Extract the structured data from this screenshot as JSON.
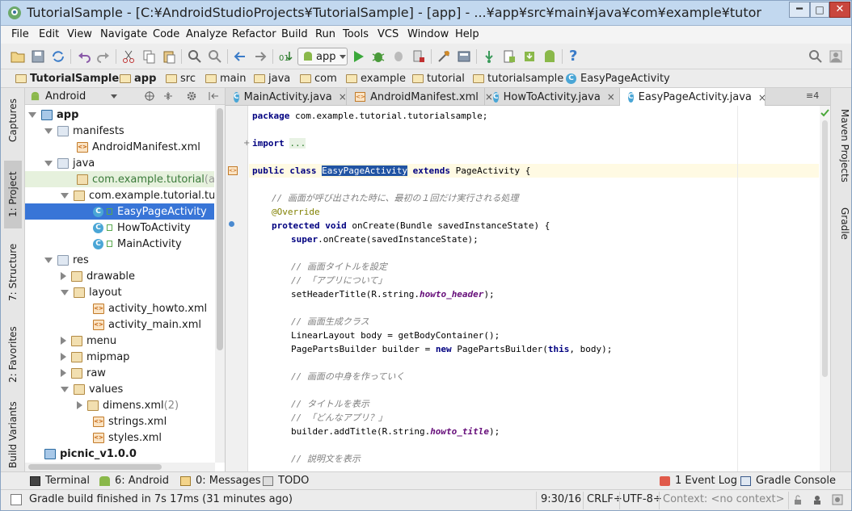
{
  "window": {
    "title": "TutorialSample - [C:¥AndroidStudioProjects¥TutorialSample] - [app] - ...¥app¥src¥main¥java¥com¥example¥tutorial¥tut...",
    "minimize": "━",
    "maximize": "□",
    "close": "✕"
  },
  "menu": [
    "File",
    "Edit",
    "View",
    "Navigate",
    "Code",
    "Analyze",
    "Refactor",
    "Build",
    "Run",
    "Tools",
    "VCS",
    "Window",
    "Help"
  ],
  "toolbar": {
    "run_config": "app",
    "help": "?"
  },
  "breadcrumbs": [
    "TutorialSample",
    "app",
    "src",
    "main",
    "java",
    "com",
    "example",
    "tutorial",
    "tutorialsample",
    "EasyPageActivity"
  ],
  "left_tabs": [
    "Captures",
    "1: Project",
    "7: Structure",
    "2: Favorites",
    "Build Variants"
  ],
  "project_panel": {
    "view": "Android",
    "tree": [
      {
        "label": "app",
        "bold": true
      },
      {
        "label": "manifests"
      },
      {
        "label": "AndroidManifest.xml"
      },
      {
        "label": "java"
      },
      {
        "label": "com.example.tutorial",
        "suffix": " (anc"
      },
      {
        "label": "com.example.tutorial.tuto"
      },
      {
        "label": "EasyPageActivity"
      },
      {
        "label": "HowToActivity"
      },
      {
        "label": "MainActivity"
      },
      {
        "label": "res"
      },
      {
        "label": "drawable"
      },
      {
        "label": "layout"
      },
      {
        "label": "activity_howto.xml"
      },
      {
        "label": "activity_main.xml"
      },
      {
        "label": "menu"
      },
      {
        "label": "mipmap"
      },
      {
        "label": "raw"
      },
      {
        "label": "values"
      },
      {
        "label": "dimens.xml",
        "suffix": " (2)"
      },
      {
        "label": "strings.xml"
      },
      {
        "label": "styles.xml"
      },
      {
        "label": "picnic_v1.0.0",
        "bold": true
      }
    ]
  },
  "editor_tabs": [
    {
      "label": "MainActivity.java",
      "close": "×"
    },
    {
      "label": "AndroidManifest.xml",
      "close": "×"
    },
    {
      "label": "HowToActivity.java",
      "close": "×"
    },
    {
      "label": "EasyPageActivity.java",
      "close": "×"
    }
  ],
  "editor_tabs_overflow": "≡4",
  "code": {
    "l1a": "package ",
    "l1b": "com.example.tutorial.tutorialsample;",
    "l2a": "import ",
    "l2b": "...",
    "l3a": "public class ",
    "l3b": "EasyPageActivity",
    "l3c": " extends ",
    "l3d": "PageActivity {",
    "l4": "// 画面が呼び出された時に、最初の１回だけ実行される処理",
    "l5": "@Override",
    "l6a": "protected void ",
    "l6b": "onCreate(Bundle savedInstanceState) {",
    "l7a": "super",
    "l7b": ".onCreate(savedInstanceState);",
    "l8": "// 画面タイトルを設定",
    "l9": "// 「アプリについて」",
    "l10a": "setHeaderTitle(R.string.",
    "l10b": "howto_header",
    "l10c": ");",
    "l11": "// 画面生成クラス",
    "l12": "LinearLayout body = getBodyContainer();",
    "l13a": "PagePartsBuilder builder = ",
    "l13b": "new ",
    "l13c": "PagePartsBuilder(",
    "l13d": "this",
    ", body);": "",
    "l13e": ", body);",
    "l14": "// 画面の中身を作っていく",
    "l15": "// タイトルを表示",
    "l16": "// 「どんなアプリ？」",
    "l17a": "builder.addTitle(R.string.",
    "l17b": "howto_title",
    "l17c": ");",
    "l18": "// 説明文を表示"
  },
  "right_tabs": [
    "Maven Projects",
    "Gradle"
  ],
  "bottom_tabs": [
    "Terminal",
    "6: Android",
    "0: Messages",
    "TODO",
    "1 Event Log",
    "Gradle Console"
  ],
  "status": {
    "message": "Gradle build finished in 7s 17ms (31 minutes ago)",
    "position": "9:30/16",
    "line_sep": "CRLF÷",
    "encoding": "UTF-8÷",
    "context": "Context: <no context>"
  },
  "colors": {
    "selection": "#3875d7",
    "keyword": "#000080",
    "comment": "#808080",
    "annotation": "#808000",
    "field": "#660e7a",
    "titlebar": "#c2d8ef"
  }
}
